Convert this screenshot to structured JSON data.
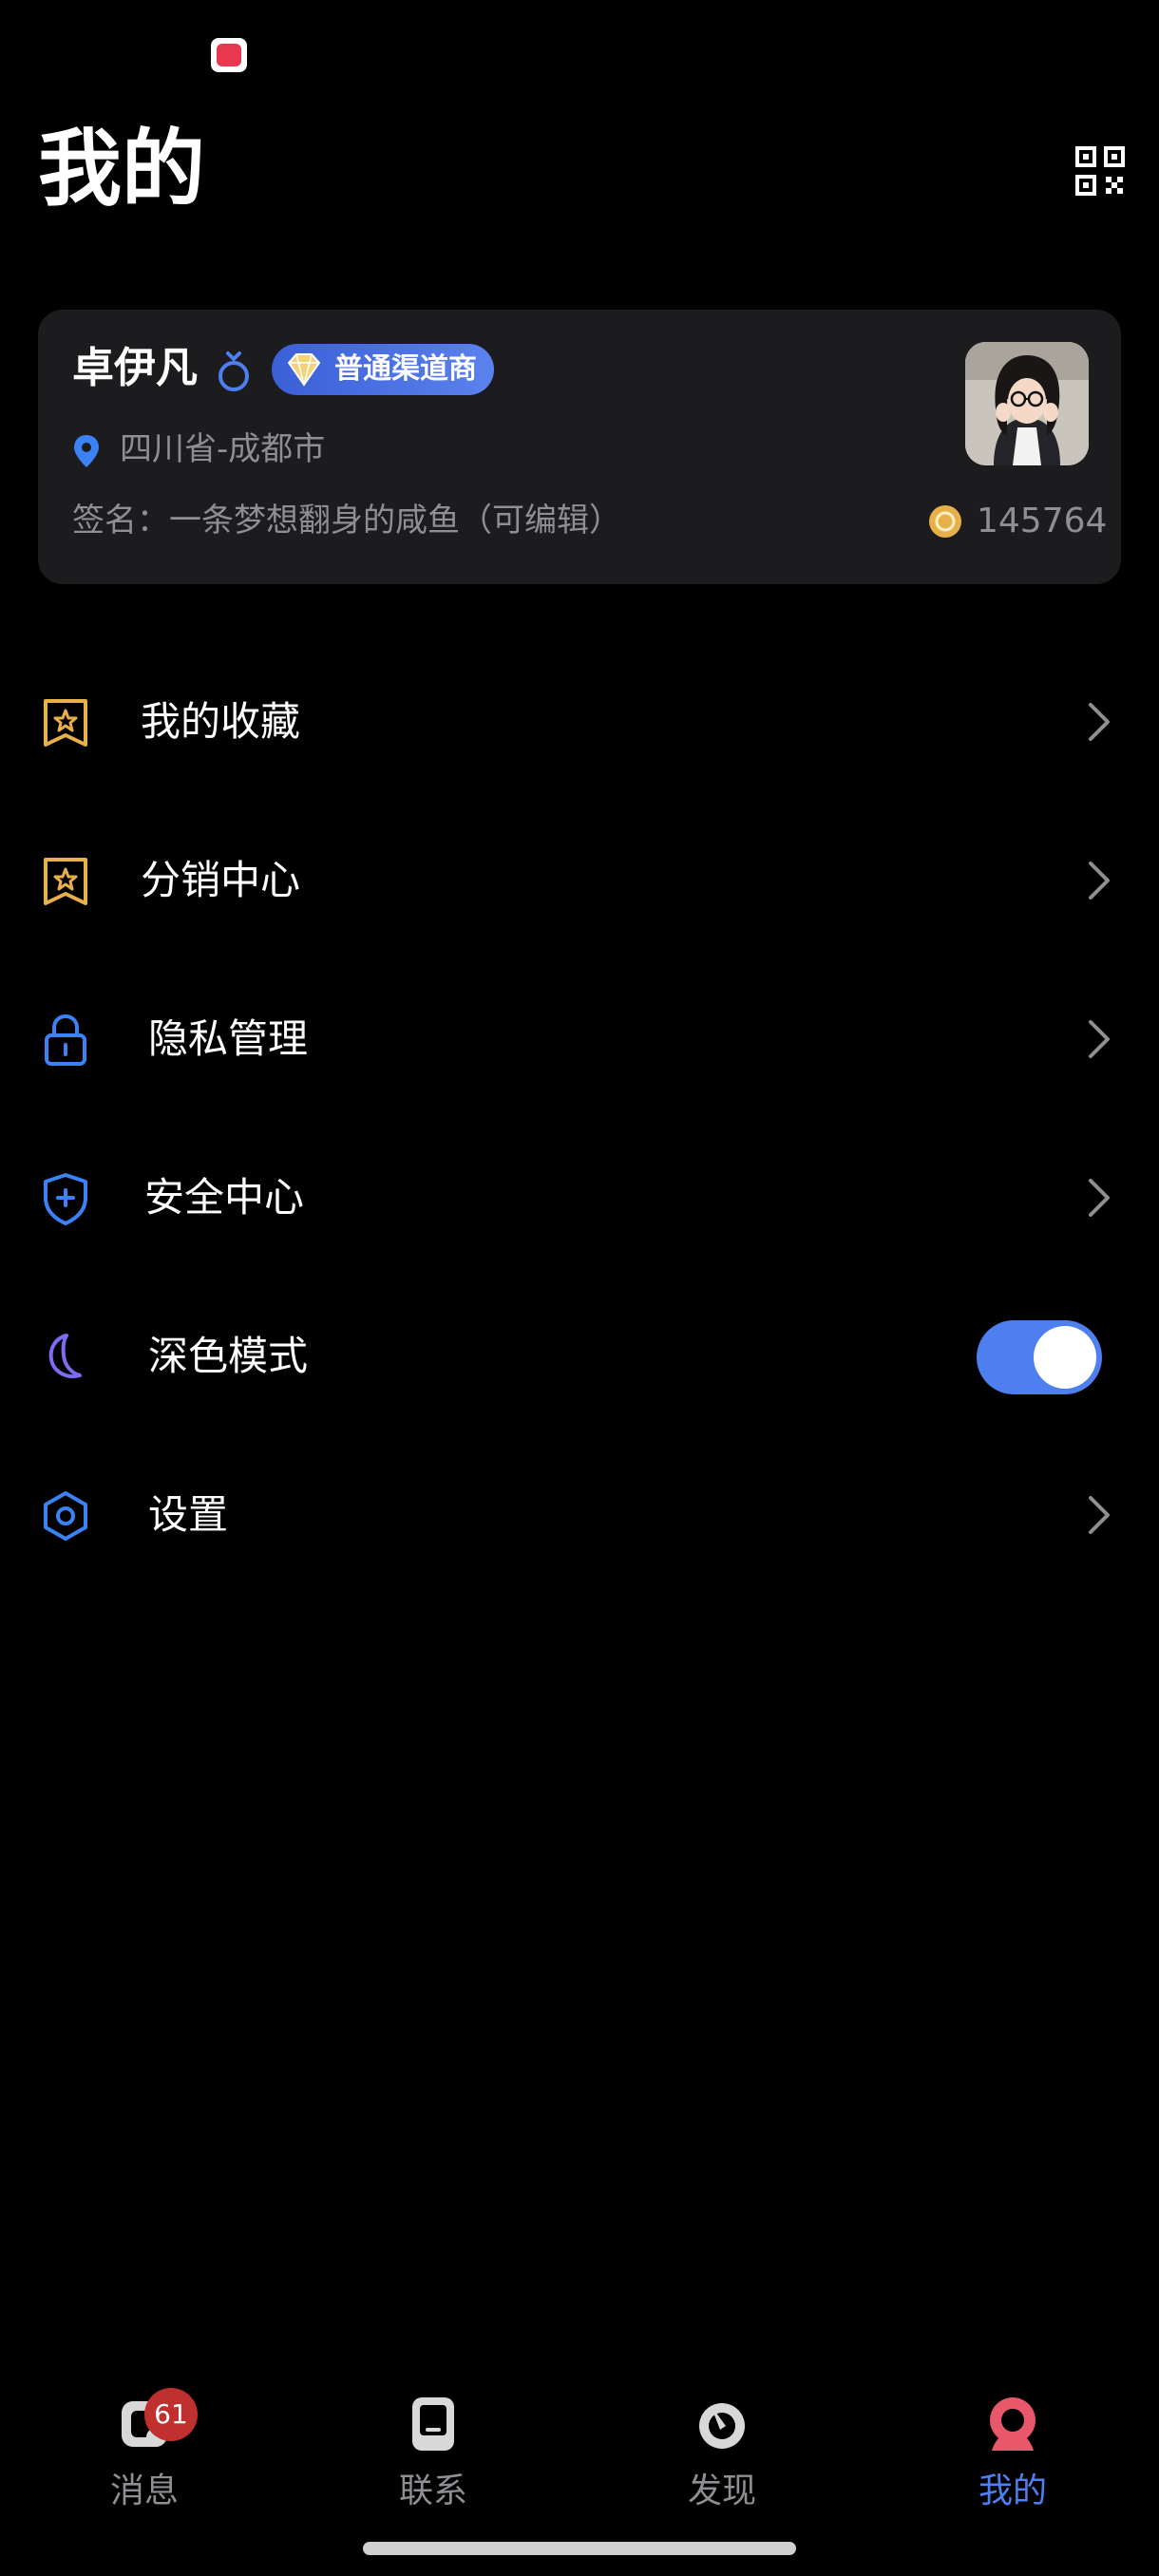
{
  "header": {
    "title": "我的"
  },
  "profile": {
    "name": "卓伊凡",
    "badge": "普通渠道商",
    "location": "四川省-成都市",
    "signature": "签名：一条梦想翻身的咸鱼（可编辑）",
    "coins": "145764"
  },
  "menu": [
    {
      "label": "我的收藏",
      "icon": "bookmark-star-icon"
    },
    {
      "label": "分销中心",
      "icon": "bookmark-star-icon"
    },
    {
      "label": "隐私管理",
      "icon": "lock-icon"
    },
    {
      "label": "安全中心",
      "icon": "shield-plus-icon"
    },
    {
      "label": "深色模式",
      "icon": "moon-icon",
      "toggle": true,
      "toggle_on": true
    },
    {
      "label": "设置",
      "icon": "gear-hex-icon"
    }
  ],
  "tabs": [
    {
      "label": "消息",
      "badge": "61",
      "icon": "message-icon"
    },
    {
      "label": "联系",
      "icon": "contact-icon"
    },
    {
      "label": "发现",
      "icon": "discover-icon"
    },
    {
      "label": "我的",
      "icon": "profile-icon",
      "active": true
    }
  ],
  "colors": {
    "accent": "#4e7ff0",
    "gold_icon": "#e8b04b",
    "blue_icon": "#3b82f6",
    "purple_icon": "#7c6cf2",
    "badge_red": "#c0302e",
    "card_bg": "#1c1c1e",
    "secondary_text": "#8e8e93"
  }
}
